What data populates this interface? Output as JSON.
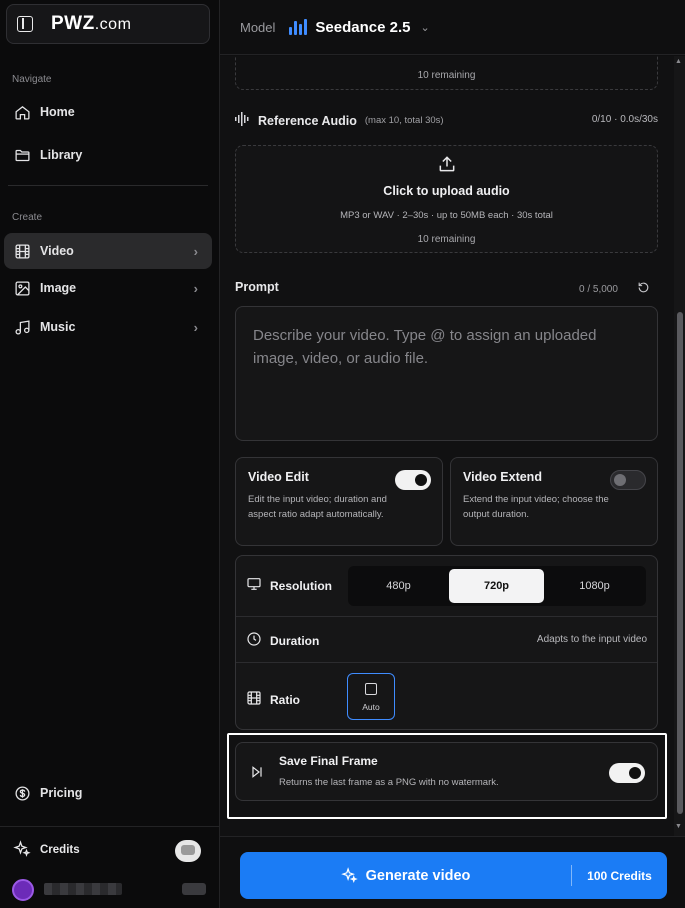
{
  "brand": {
    "name": "PWZ",
    "suffix": ".com"
  },
  "sidebar": {
    "navigate_label": "Navigate",
    "create_label": "Create",
    "items": [
      {
        "label": "Home",
        "icon": "home-icon"
      },
      {
        "label": "Library",
        "icon": "folder-icon"
      },
      {
        "label": "Video",
        "icon": "film-icon",
        "active": true
      },
      {
        "label": "Image",
        "icon": "image-icon"
      },
      {
        "label": "Music",
        "icon": "music-note-icon"
      }
    ],
    "pricing_label": "Pricing",
    "credits_label": "Credits"
  },
  "header": {
    "model_label": "Model",
    "model_name": "Seedance 2.5"
  },
  "top_upload": {
    "remaining": "10 remaining"
  },
  "reference_audio": {
    "title": "Reference Audio",
    "subtitle": "(max 10, total 30s)",
    "count": "0/10 · 0.0s/30s",
    "upload_title": "Click to upload audio",
    "upload_hint": "MP3 or WAV · 2–30s · up to 50MB each · 30s total",
    "remaining": "10 remaining"
  },
  "prompt": {
    "label": "Prompt",
    "count": "0 / 5,000",
    "placeholder": "Describe your video. Type @ to assign an uploaded image, video, or audio file."
  },
  "video_edit": {
    "title": "Video Edit",
    "desc": "Edit the input video; duration and aspect ratio adapt automatically.",
    "enabled": true
  },
  "video_extend": {
    "title": "Video Extend",
    "desc": "Extend the input video; choose the output duration.",
    "enabled": false
  },
  "settings": {
    "resolution_label": "Resolution",
    "resolution_options": [
      "480p",
      "720p",
      "1080p"
    ],
    "resolution_selected": "720p",
    "duration_label": "Duration",
    "duration_note": "Adapts to the input video",
    "ratio_label": "Ratio",
    "ratio_option": "Auto"
  },
  "save_final_frame": {
    "title": "Save Final Frame",
    "desc": "Returns the last frame as a PNG with no watermark.",
    "enabled": true
  },
  "generate": {
    "label": "Generate video",
    "credits": "100 Credits"
  },
  "colors": {
    "accent": "#1b7cf5",
    "model_icon": "#3f8cff",
    "avatar": "#6c2bb8"
  }
}
